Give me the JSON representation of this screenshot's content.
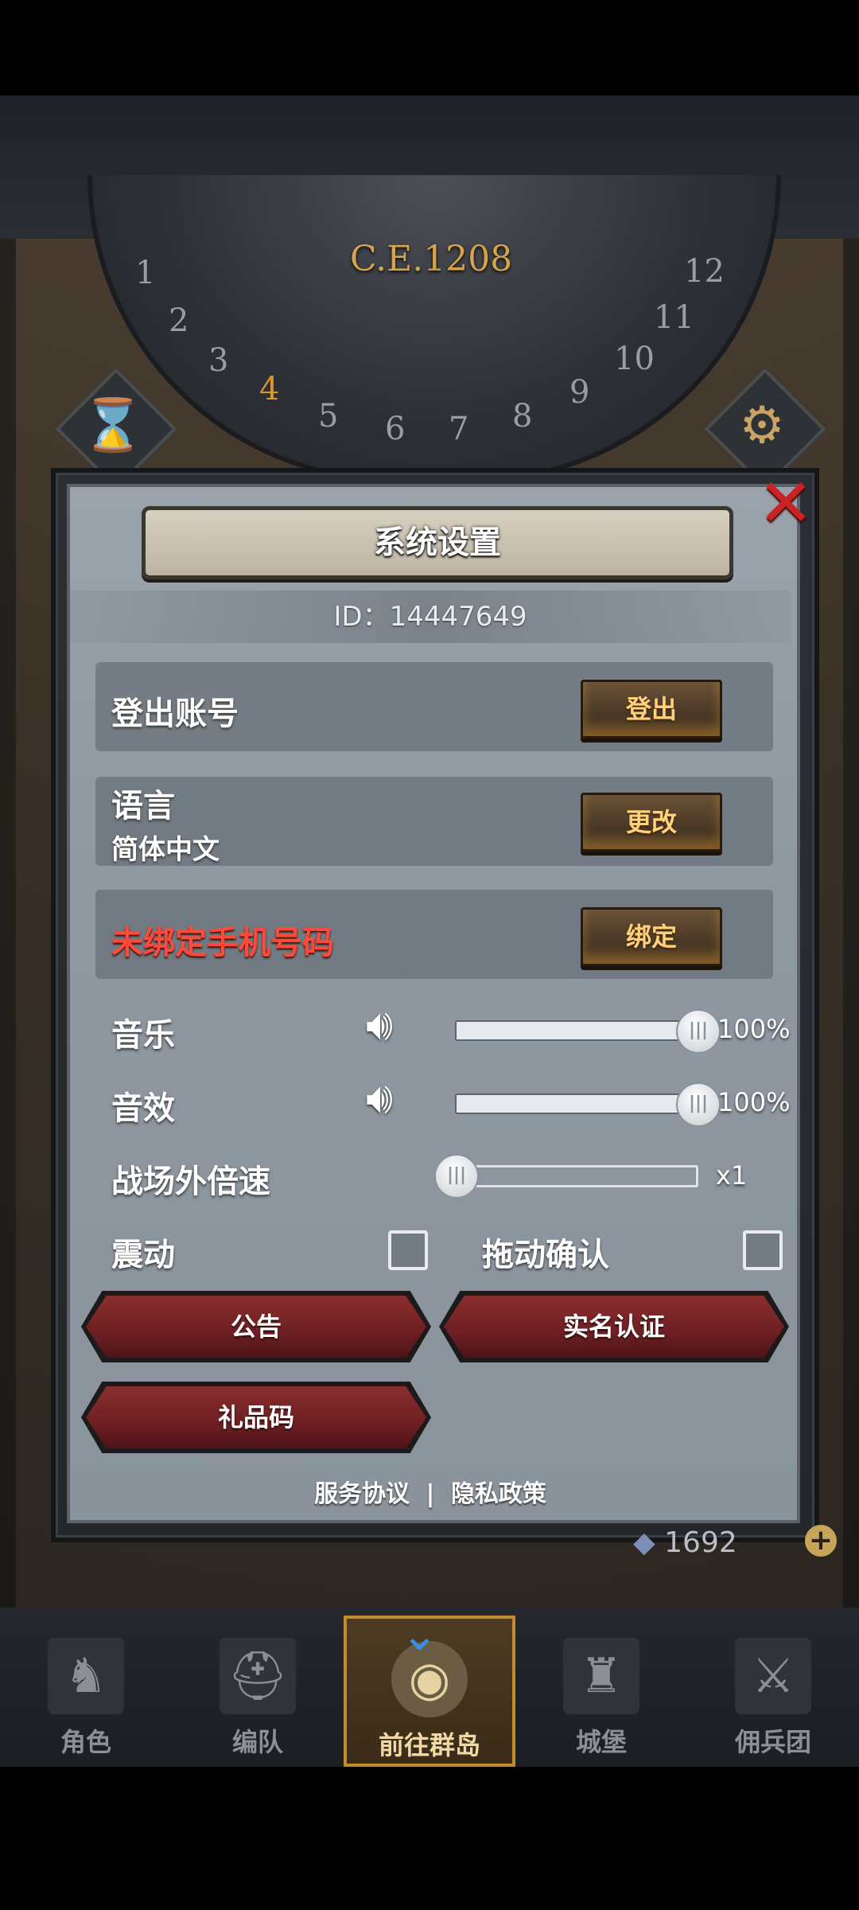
{
  "background": {
    "year": "C.E.1208",
    "dial_numbers": [
      "1",
      "2",
      "3",
      "4",
      "5",
      "6",
      "7",
      "8",
      "9",
      "10",
      "11",
      "12"
    ],
    "active_dial_number": "4"
  },
  "dialog": {
    "title": "系统设置",
    "id_line": "ID：14447649",
    "close_icon": "close-x-icon",
    "logout": {
      "label": "登出账号",
      "button": "登出"
    },
    "language": {
      "label": "语言",
      "value": "简体中文",
      "button": "更改"
    },
    "phone": {
      "label": "未绑定手机号码",
      "button": "绑定"
    },
    "music": {
      "label": "音乐",
      "value_text": "100%",
      "level": 1.0
    },
    "sfx": {
      "label": "音效",
      "value_text": "100%",
      "level": 1.0
    },
    "speed": {
      "label": "战场外倍速",
      "value_text": "x1",
      "level": 0.0
    },
    "vibration": {
      "label": "震动",
      "checked": false
    },
    "drag_confirm": {
      "label": "拖动确认",
      "checked": false
    },
    "announcement_button": "公告",
    "realname_button": "实名认证",
    "gift_code_button": "礼品码",
    "terms_link": "服务协议",
    "separator": "|",
    "privacy_link": "隐私政策"
  },
  "hud": {
    "resource_value": "1692",
    "plus_symbol": "+"
  },
  "nav": {
    "items": [
      {
        "label": "角色",
        "icon": "knight-icon"
      },
      {
        "label": "编队",
        "icon": "helmet-icon"
      },
      {
        "label": "前往群岛",
        "icon": "globe-icon"
      },
      {
        "label": "城堡",
        "icon": "castle-icon"
      },
      {
        "label": "佣兵团",
        "icon": "mercenary-icon"
      }
    ],
    "active_index": 2
  },
  "colors": {
    "warning_text": "#ff4a3a",
    "button_gold_text": "#ffd27a",
    "accent_gold": "#c48a2e",
    "dialog_bg": "#8f98a1"
  }
}
